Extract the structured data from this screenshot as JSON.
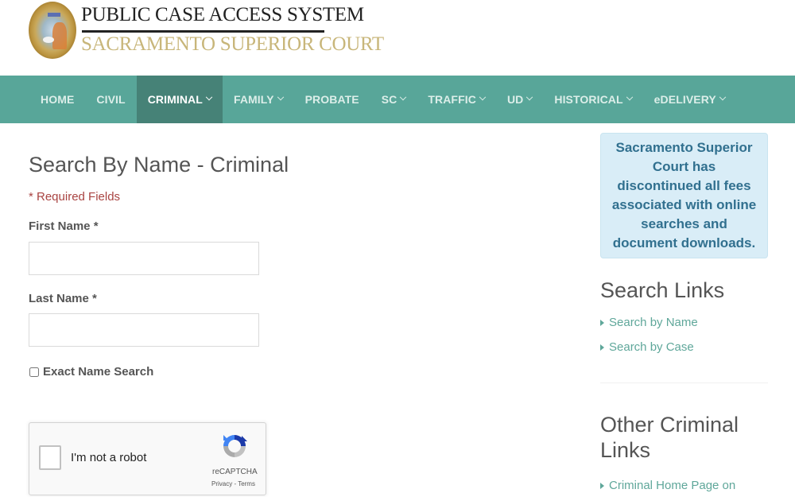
{
  "header": {
    "title": "PUBLIC CASE ACCESS SYSTEM",
    "subtitle": "SACRAMENTO SUPERIOR COURT",
    "logo_icon": "court-seal"
  },
  "nav": {
    "items": [
      {
        "label": "HOME",
        "dropdown": false,
        "active": false
      },
      {
        "label": "CIVIL",
        "dropdown": false,
        "active": false
      },
      {
        "label": "CRIMINAL",
        "dropdown": true,
        "active": true
      },
      {
        "label": "FAMILY",
        "dropdown": true,
        "active": false
      },
      {
        "label": "PROBATE",
        "dropdown": false,
        "active": false
      },
      {
        "label": "SC",
        "dropdown": true,
        "active": false
      },
      {
        "label": "TRAFFIC",
        "dropdown": true,
        "active": false
      },
      {
        "label": "UD",
        "dropdown": true,
        "active": false
      },
      {
        "label": "HISTORICAL",
        "dropdown": true,
        "active": false
      },
      {
        "label": "eDELIVERY",
        "dropdown": true,
        "active": false
      }
    ]
  },
  "main": {
    "title": "Search By Name - Criminal",
    "required_note": "* Required Fields",
    "first_name": {
      "label": "First Name *",
      "value": "",
      "placeholder": ""
    },
    "last_name": {
      "label": "Last Name *",
      "value": "",
      "placeholder": ""
    },
    "exact_name": {
      "label": "Exact Name Search",
      "checked": false
    },
    "captcha": {
      "label": "I'm not a robot",
      "brand": "reCAPTCHA",
      "terms": "Privacy - Terms",
      "checked": false
    }
  },
  "sidebar": {
    "notice": "Sacramento Superior Court has discontinued all fees associated with online searches and document downloads.",
    "search_links": {
      "heading": "Search Links",
      "items": [
        "Search by Name",
        "Search by Case"
      ]
    },
    "other_links": {
      "heading": "Other Criminal Links",
      "items": [
        "Criminal Home Page on"
      ]
    }
  },
  "colors": {
    "nav_bg": "#58a699",
    "nav_active_bg": "#468277",
    "link": "#5fa79a",
    "required": "#a94442",
    "notice_bg": "#d9edf7",
    "notice_text": "#31708f"
  }
}
